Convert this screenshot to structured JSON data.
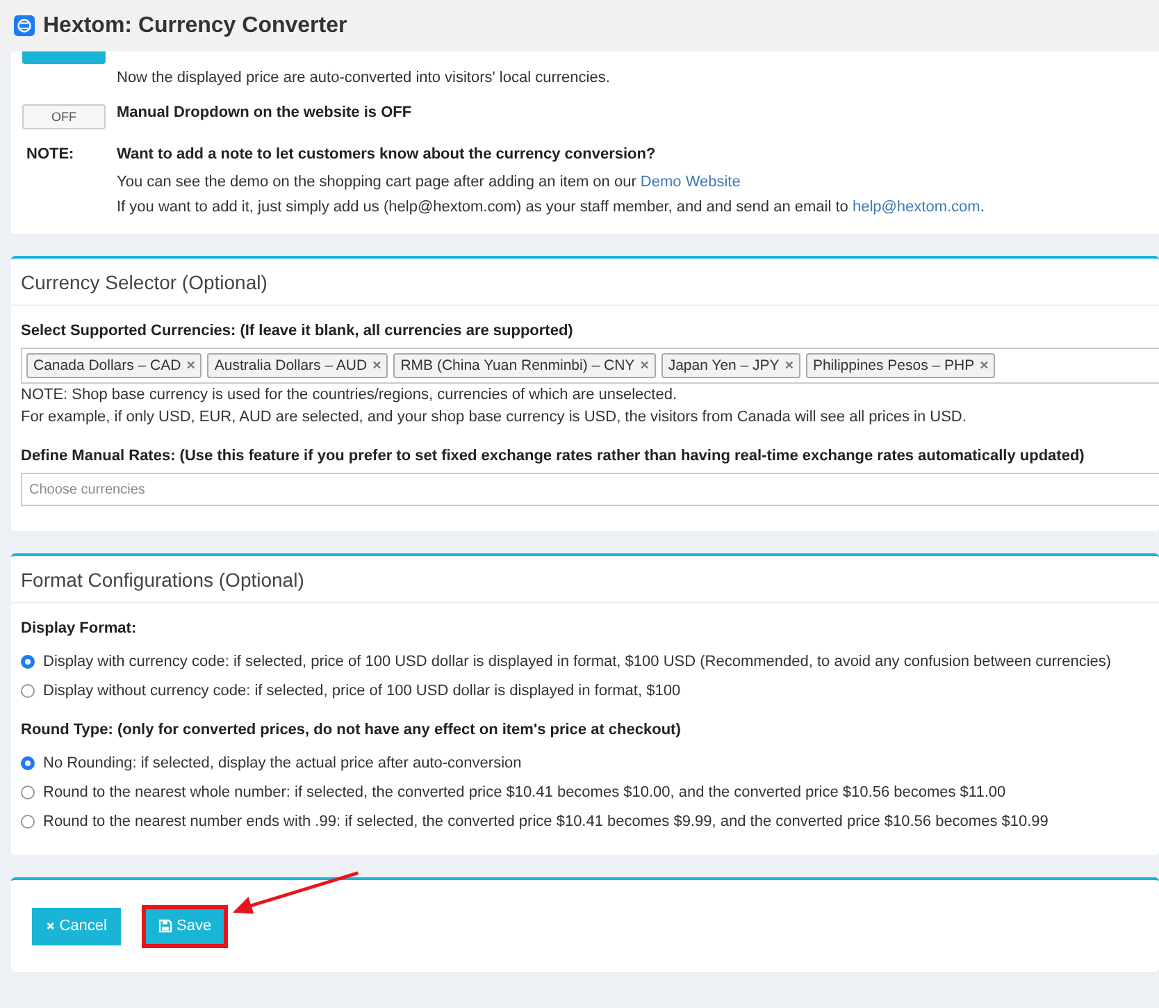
{
  "window": {
    "title": "Hextom: Currency Converter"
  },
  "app_section": {
    "toggles": [
      {
        "on": true,
        "description": "Now the displayed price are auto-converted into visitors' local currencies."
      },
      {
        "on": false,
        "label": "OFF",
        "title": "Manual Dropdown on the website is OFF"
      }
    ],
    "note": {
      "label": "NOTE:",
      "title": "Want to add a note to let customers know about the currency conversion?",
      "line_1": "You can see the demo on the shopping cart page after adding an item on our ",
      "line_1_link": "Demo Website",
      "line_2": "If you want to add it, just simply add us (help@hextom.com) as your staff member, and and send an email to ",
      "line_2_link": "help@hextom.com",
      "line_2_end": "."
    }
  },
  "currency_selector": {
    "title": "Currency Selector (Optional)",
    "supported_label": "Select Supported Currencies: (If leave it blank, all currencies are supported)",
    "tags": [
      "Canada Dollars – CAD",
      "Australia Dollars – AUD",
      "RMB (China Yuan Renminbi) – CNY",
      "Japan Yen – JPY",
      "Philippines Pesos – PHP"
    ],
    "remove_glyph": "×",
    "notes": [
      "NOTE: Shop base currency is used for the countries/regions, currencies of which are unselected.",
      "For example, if only USD, EUR, AUD are selected, and your shop base currency is USD, the visitors from Canada will see all prices in USD."
    ],
    "manual_label": "Define Manual Rates: (Use this feature if you prefer to set fixed exchange rates rather than having real-time exchange rates automatically updated)",
    "manual_field": {
      "placeholder": "Choose currencies"
    }
  },
  "format_config": {
    "title": "Format Configurations (Optional)",
    "groups": [
      {
        "label": "Display Format:",
        "options": [
          {
            "text": "Display with currency code: if selected, price of 100 USD dollar is displayed in format, $100 USD (Recommended, to avoid any confusion between currencies)",
            "selected": true
          },
          {
            "text": "Display without currency code: if selected, price of 100 USD dollar is displayed in format, $100",
            "selected": false
          }
        ]
      },
      {
        "label": "Round Type: (only for converted prices, do not have any effect on item's price at checkout)",
        "options": [
          {
            "text": "No Rounding: if selected, display the actual price after auto-conversion",
            "selected": true
          },
          {
            "text": "Round to the nearest whole number: if selected, the converted price $10.41 becomes $10.00, and the converted price $10.56 becomes $11.00",
            "selected": false
          },
          {
            "text": "Round to the nearest number ends with .99: if selected, the converted price $10.41 becomes $9.99, and the converted price $10.56 becomes $10.99",
            "selected": false
          }
        ]
      }
    ]
  },
  "actions": [
    {
      "kind": "cancel",
      "label": "Cancel",
      "highlighted": false
    },
    {
      "kind": "save",
      "label": "Save",
      "highlighted": true
    }
  ]
}
